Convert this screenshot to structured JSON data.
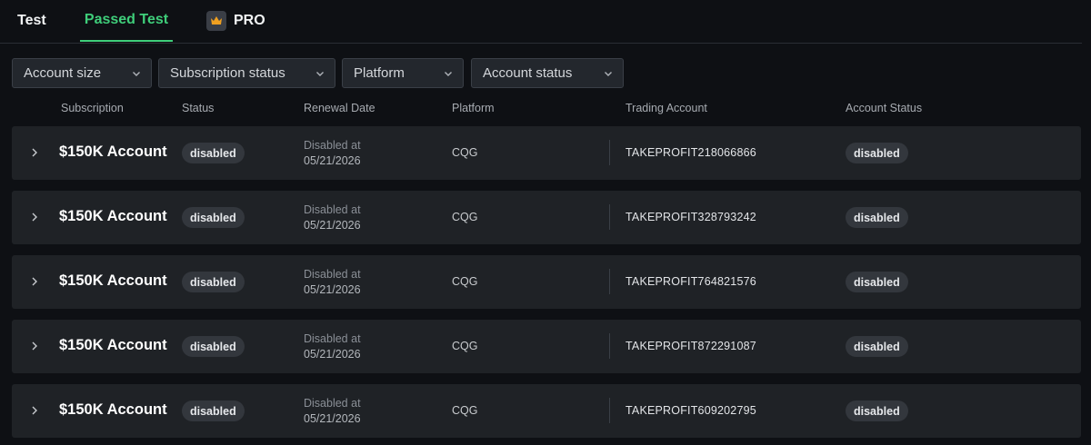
{
  "tabs": {
    "test": "Test",
    "passed": "Passed Test",
    "pro": "PRO",
    "pro_icon": "crown-icon"
  },
  "filters": {
    "account_size": "Account size",
    "subscription_status": "Subscription status",
    "platform": "Platform",
    "account_status": "Account status"
  },
  "columns": {
    "subscription": "Subscription",
    "status": "Status",
    "renewal_date": "Renewal Date",
    "platform": "Platform",
    "trading_account": "Trading Account",
    "account_status": "Account Status"
  },
  "rows": [
    {
      "name": "$150K Account",
      "status": "disabled",
      "renewal_label": "Disabled at",
      "renewal_date": "05/21/2026",
      "platform": "CQG",
      "trading_account": "TAKEPROFIT218066866",
      "account_status": "disabled"
    },
    {
      "name": "$150K Account",
      "status": "disabled",
      "renewal_label": "Disabled at",
      "renewal_date": "05/21/2026",
      "platform": "CQG",
      "trading_account": "TAKEPROFIT328793242",
      "account_status": "disabled"
    },
    {
      "name": "$150K Account",
      "status": "disabled",
      "renewal_label": "Disabled at",
      "renewal_date": "05/21/2026",
      "platform": "CQG",
      "trading_account": "TAKEPROFIT764821576",
      "account_status": "disabled"
    },
    {
      "name": "$150K Account",
      "status": "disabled",
      "renewal_label": "Disabled at",
      "renewal_date": "05/21/2026",
      "platform": "CQG",
      "trading_account": "TAKEPROFIT872291087",
      "account_status": "disabled"
    },
    {
      "name": "$150K Account",
      "status": "disabled",
      "renewal_label": "Disabled at",
      "renewal_date": "05/21/2026",
      "platform": "CQG",
      "trading_account": "TAKEPROFIT609202795",
      "account_status": "disabled"
    }
  ],
  "colors": {
    "accent": "#3fce7a",
    "background": "#0e1014",
    "row_bg": "#1f2226",
    "crown": "#f0a020"
  }
}
